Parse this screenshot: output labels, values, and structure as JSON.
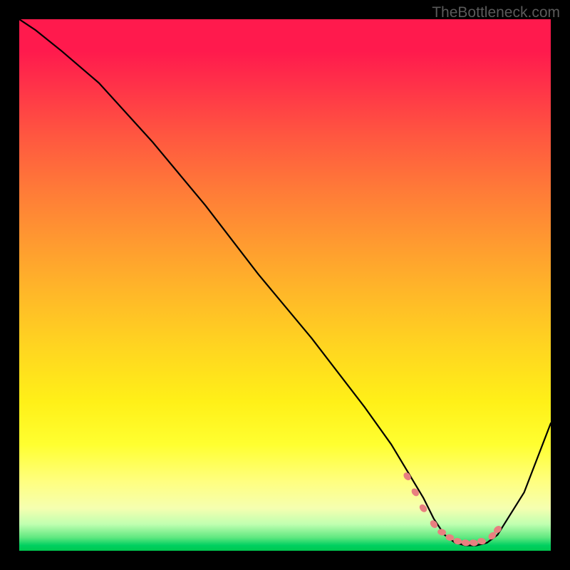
{
  "watermark": "TheBottleneck.com",
  "chart_data": {
    "type": "line",
    "title": "",
    "xlabel": "",
    "ylabel": "",
    "xlim": [
      0,
      100
    ],
    "ylim": [
      0,
      100
    ],
    "series": [
      {
        "name": "curve",
        "x": [
          0,
          3,
          8,
          15,
          25,
          35,
          45,
          55,
          65,
          70,
          73,
          76,
          78,
          80,
          82,
          84,
          86,
          88,
          90,
          95,
          100
        ],
        "y": [
          100,
          98,
          94,
          88,
          77,
          65,
          52,
          40,
          27,
          20,
          15,
          10,
          6,
          3,
          1.5,
          1,
          1,
          1.5,
          3,
          11,
          24
        ],
        "color": "#000000"
      },
      {
        "name": "highlight-dots",
        "x": [
          73,
          74.5,
          76,
          78,
          79.5,
          81,
          82.5,
          84,
          85.5,
          87,
          89,
          90
        ],
        "y": [
          14,
          11,
          8,
          5,
          3.5,
          2.5,
          1.8,
          1.5,
          1.5,
          1.8,
          2.8,
          4
        ],
        "color": "#e88080"
      }
    ],
    "background_gradient": {
      "top": "#ff1a4d",
      "middle": "#ffe020",
      "bottom": "#00d060"
    }
  }
}
